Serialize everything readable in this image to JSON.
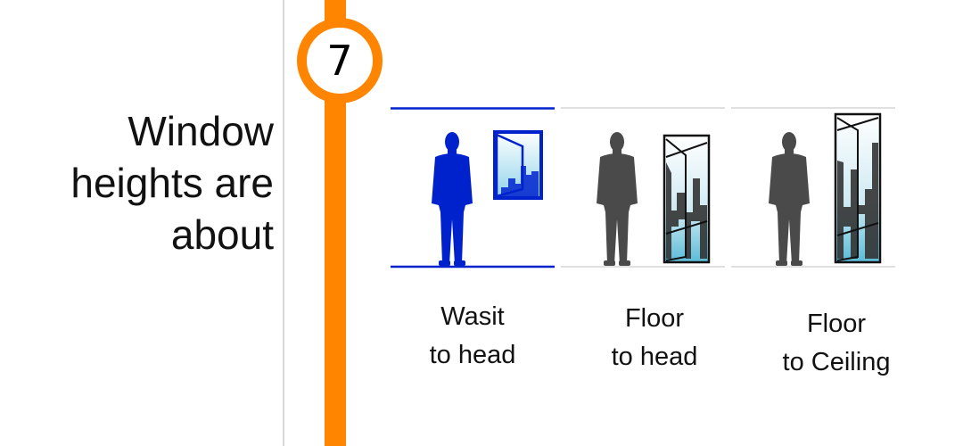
{
  "step": {
    "number": "7"
  },
  "lead": {
    "lines": [
      "Window",
      "heights are",
      "about"
    ]
  },
  "colors": {
    "accent": "#ff8400",
    "selected": "#0022cc",
    "unselected": "#4a4a4a"
  },
  "options": [
    {
      "line1": "Wasit",
      "line2": "to head",
      "selected": true,
      "icon": "person-with-window-waist-to-head-icon"
    },
    {
      "line1": "Floor",
      "line2": "to head",
      "selected": false,
      "icon": "person-with-window-floor-to-head-icon"
    },
    {
      "line1": "Floor",
      "line2": "to Ceiling",
      "selected": false,
      "icon": "person-with-window-floor-to-ceiling-icon"
    }
  ]
}
